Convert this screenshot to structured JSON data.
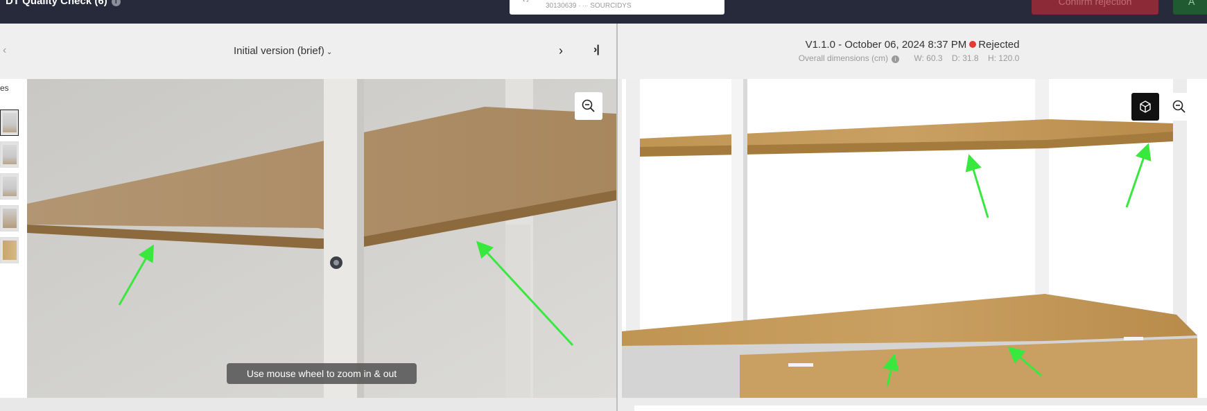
{
  "header": {
    "title": "DT Quality Check (6)",
    "product": {
      "id": "30130639",
      "separator": "·",
      "brand": "SOURCIDYS"
    },
    "confirm_rejection_label": "Confirm rejection",
    "accept_label": "A"
  },
  "left_panel": {
    "version_label": "Initial version (brief)",
    "thumbnails_label": "es",
    "hint": "Use mouse wheel to zoom in & out"
  },
  "right_panel": {
    "version": "V1.1.0 - October 06, 2024 8:37 PM",
    "status": "Rejected",
    "status_color": "#e53935",
    "dimensions_label": "Overall dimensions (cm)",
    "width": "W: 60.3",
    "depth": "D: 31.8",
    "height": "H: 120.0"
  },
  "icons": [
    "info-icon",
    "chevron-left-icon",
    "chevron-down-icon",
    "chevron-right-icon",
    "skip-to-last-icon",
    "zoom-out-icon",
    "cube-icon",
    "arrow-annotation"
  ],
  "colors": {
    "topbar": "#262a3a",
    "annotation": "#39e83e",
    "reject": "#8d2a37",
    "accept": "#1f5a30"
  }
}
